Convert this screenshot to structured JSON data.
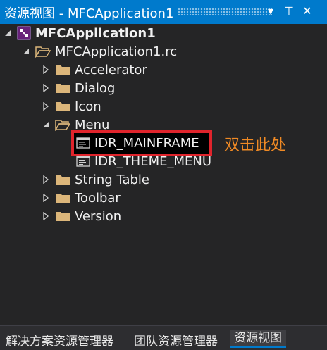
{
  "window": {
    "title": "资源视图 - MFCApplication1",
    "dropdown_glyph": "▾",
    "pin_glyph": "⊤",
    "close_glyph": "✕"
  },
  "tree": {
    "root": {
      "label": "MFCApplication1",
      "expanded": true,
      "icon": "project-icon"
    },
    "rc_file": {
      "label": "MFCApplication1.rc",
      "expanded": true,
      "icon": "open-folder-icon"
    },
    "folders": [
      {
        "label": "Accelerator",
        "expanded": false
      },
      {
        "label": "Dialog",
        "expanded": false
      },
      {
        "label": "Icon",
        "expanded": false
      },
      {
        "label": "Menu",
        "expanded": true
      },
      {
        "label": "String Table",
        "expanded": false
      },
      {
        "label": "Toolbar",
        "expanded": false
      },
      {
        "label": "Version",
        "expanded": false
      }
    ],
    "menu_items": [
      {
        "label": "IDR_MAINFRAME",
        "highlighted": true
      },
      {
        "label": "IDR_THEME_MENU",
        "highlighted": false
      }
    ]
  },
  "annotation": {
    "text": "双击此处",
    "color": "#f08a24",
    "box_color": "#e0242c"
  },
  "bottom_tabs": [
    {
      "label": "解决方案资源管理器",
      "active": false
    },
    {
      "label": "团队资源管理器",
      "active": false
    },
    {
      "label": "资源视图",
      "active": true
    }
  ],
  "colors": {
    "accent": "#007acc",
    "background": "#252526",
    "folder": "#dcb67a"
  }
}
